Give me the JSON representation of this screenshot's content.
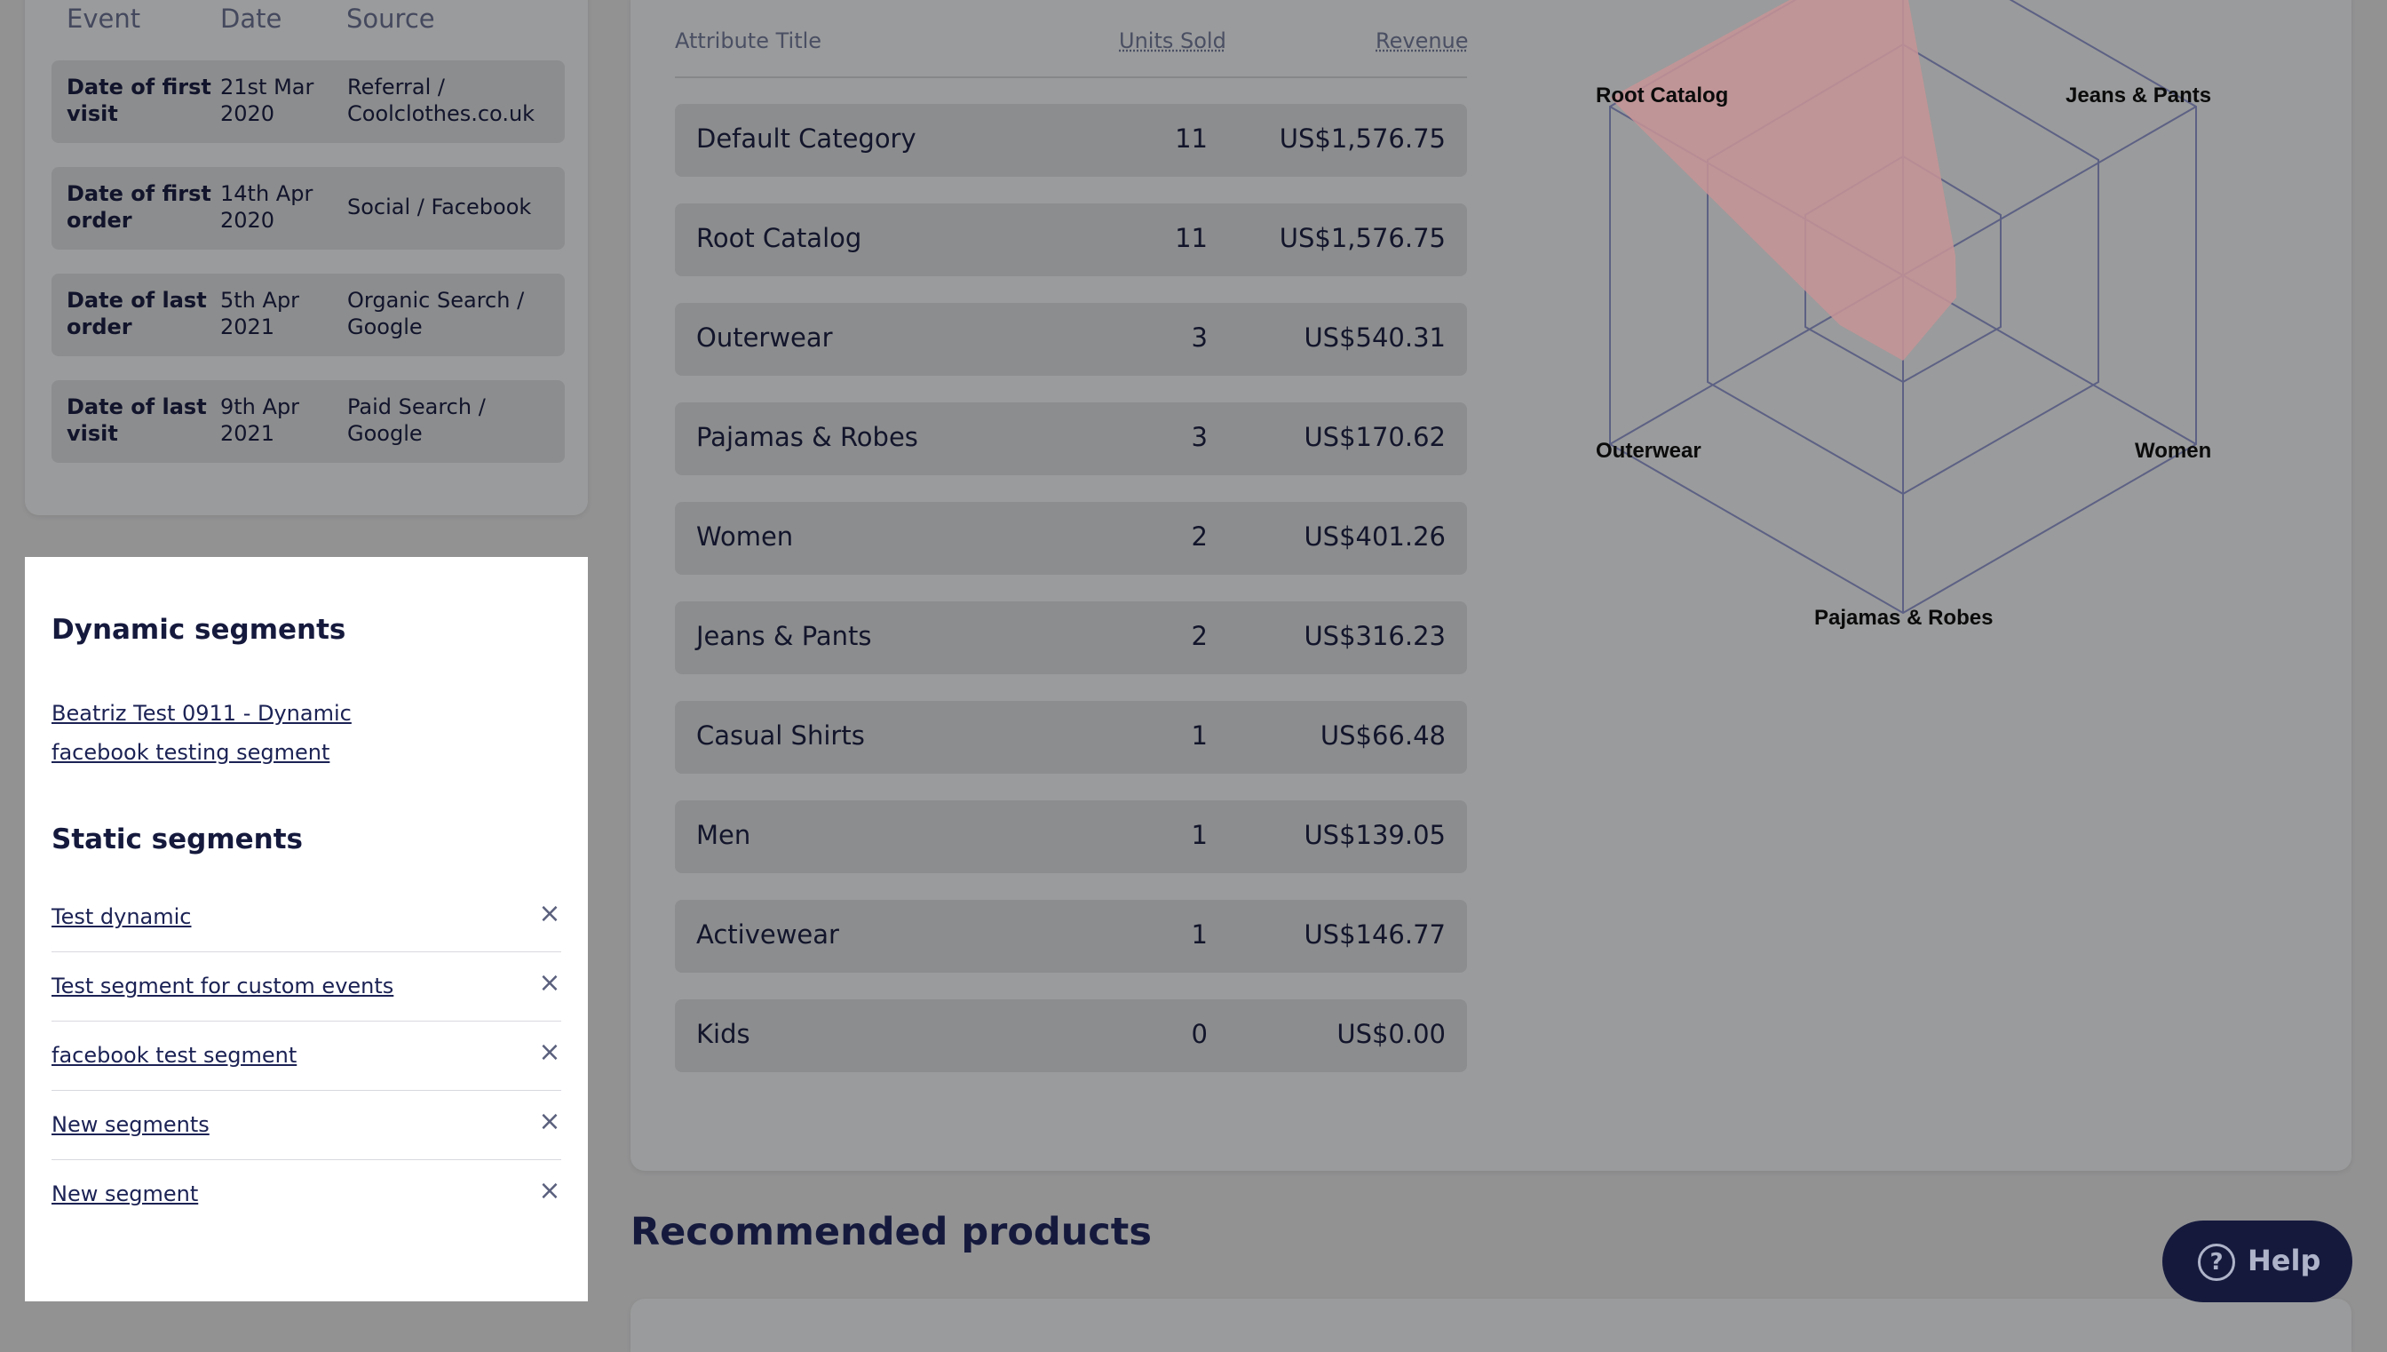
{
  "events": {
    "headers": [
      "Event",
      "Date",
      "Source"
    ],
    "rows": [
      {
        "event": [
          "Date of first",
          "visit"
        ],
        "date": [
          "21st Mar",
          "2020"
        ],
        "source": [
          "Referral /",
          "Coolclothes.co.uk"
        ]
      },
      {
        "event": [
          "Date of first",
          "order"
        ],
        "date": [
          "14th Apr",
          "2020"
        ],
        "source": [
          "Social / Facebook",
          ""
        ]
      },
      {
        "event": [
          "Date of last",
          "order"
        ],
        "date": [
          "5th Apr",
          "2021"
        ],
        "source": [
          "Organic Search /",
          "Google"
        ]
      },
      {
        "event": [
          "Date of last",
          "visit"
        ],
        "date": [
          "9th Apr",
          "2021"
        ],
        "source": [
          "Paid Search /",
          "Google"
        ]
      }
    ]
  },
  "segments": {
    "dynamic_title": "Dynamic segments",
    "dynamic_link": [
      "Beatriz Test 0911 - Dynamic",
      "facebook testing segment"
    ],
    "static_title": "Static segments",
    "static_items": [
      "Test dynamic",
      "Test segment for custom events",
      "facebook test segment",
      "New segments",
      "New segment"
    ],
    "remove_glyph": "×"
  },
  "attributes": {
    "headers": {
      "title": "Attribute Title",
      "units": "Units Sold",
      "revenue": "Revenue"
    },
    "rows": [
      {
        "name": "Default Category",
        "units": "11",
        "revenue": "US$1,576.75"
      },
      {
        "name": "Root Catalog",
        "units": "11",
        "revenue": "US$1,576.75"
      },
      {
        "name": "Outerwear",
        "units": "3",
        "revenue": "US$540.31"
      },
      {
        "name": "Pajamas & Robes",
        "units": "3",
        "revenue": "US$170.62"
      },
      {
        "name": "Women",
        "units": "2",
        "revenue": "US$401.26"
      },
      {
        "name": "Jeans & Pants",
        "units": "2",
        "revenue": "US$316.23"
      },
      {
        "name": "Casual Shirts",
        "units": "1",
        "revenue": "US$66.48"
      },
      {
        "name": "Men",
        "units": "1",
        "revenue": "US$139.05"
      },
      {
        "name": "Activewear",
        "units": "1",
        "revenue": "US$146.77"
      },
      {
        "name": "Kids",
        "units": "0",
        "revenue": "US$0.00"
      }
    ]
  },
  "radar": {
    "labels": {
      "top_left": "Root Catalog",
      "top_right": "Jeans & Pants",
      "left": "Outerwear",
      "right": "Women",
      "bottom": "Pajamas & Robes"
    },
    "fill_color": "#c79496",
    "grid_color": "#5d6184"
  },
  "recommended": {
    "title": "Recommended products"
  },
  "help": {
    "icon": "?",
    "label": "Help"
  }
}
